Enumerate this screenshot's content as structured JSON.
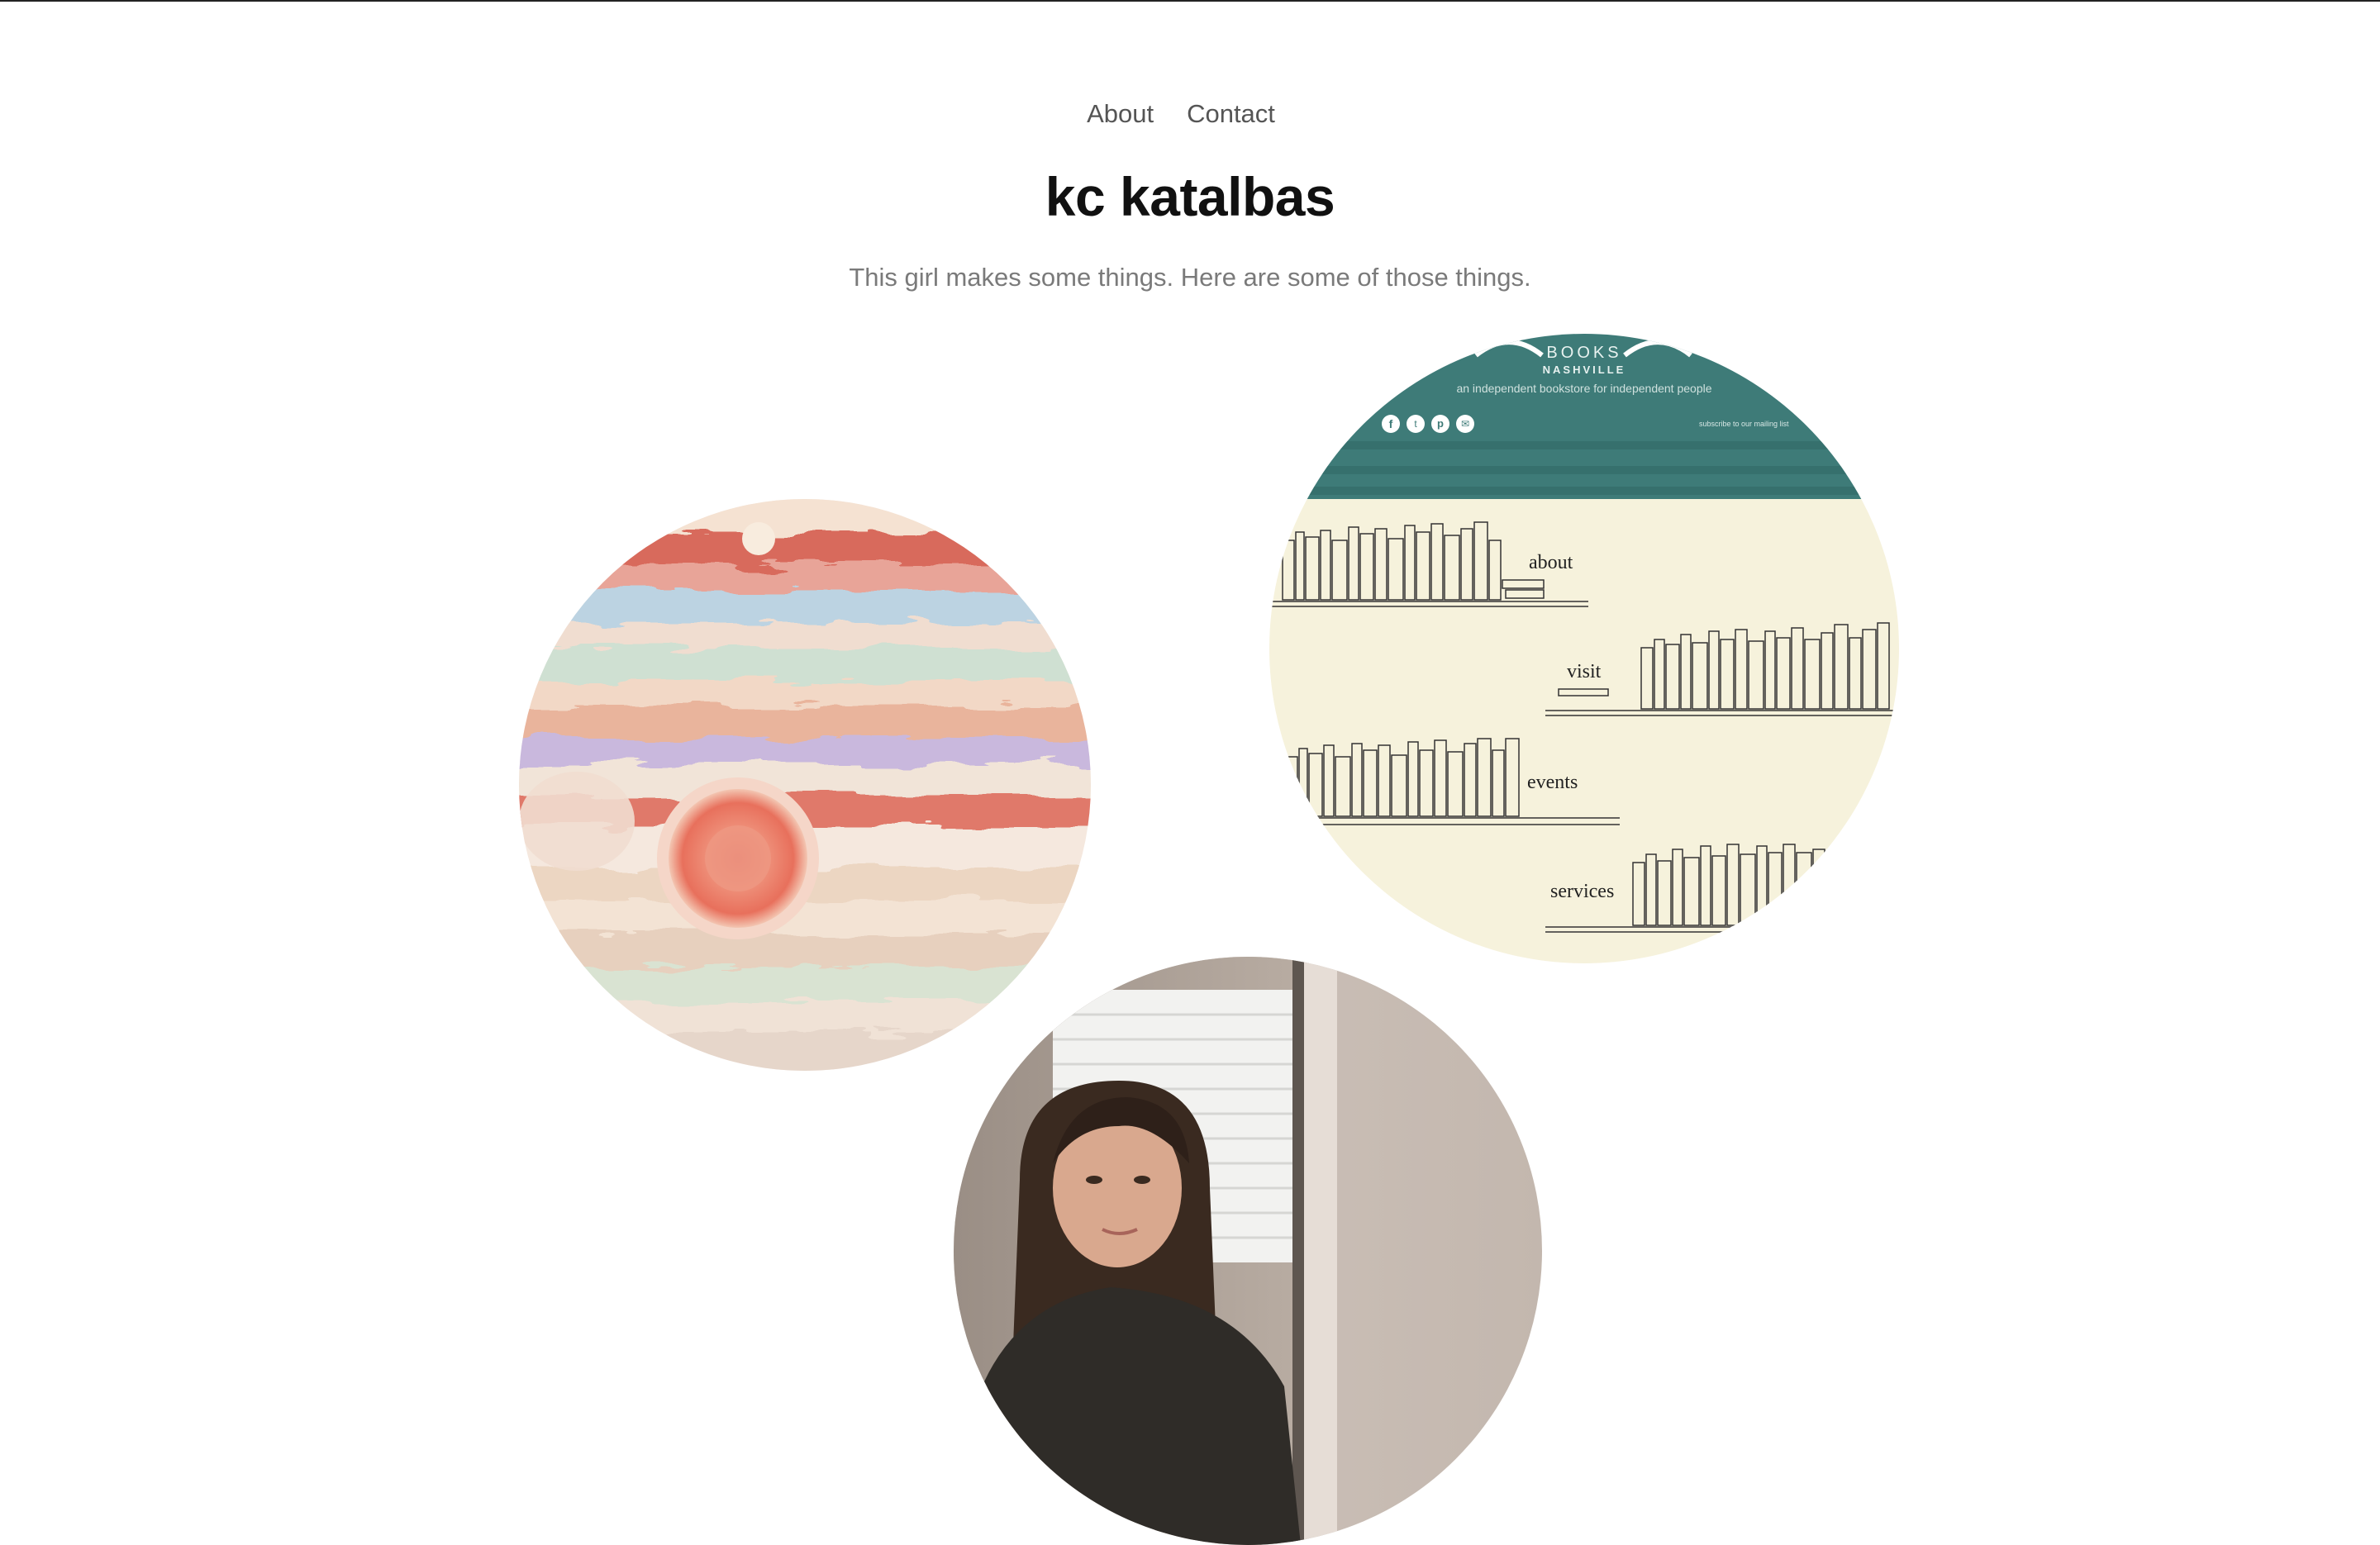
{
  "nav": {
    "about": "About",
    "contact": "Contact"
  },
  "site": {
    "title": "kc katalbas",
    "tagline": "This girl makes some things. Here are some of those things."
  },
  "projects": {
    "jupiter": {
      "kind": "painting"
    },
    "bookstore": {
      "header_name": "BOOKS",
      "header_city": "NASHVILLE",
      "header_tagline": "an independent bookstore for independent people",
      "newsletter": "subscribe to our mailing list",
      "social": [
        "facebook-icon",
        "twitter-icon",
        "pinterest-icon",
        "email-icon"
      ],
      "menu": [
        "about",
        "visit",
        "events",
        "services"
      ]
    },
    "person": {
      "kind": "photo"
    }
  },
  "colors": {
    "title": "#111111",
    "nav": "#555555",
    "tagline": "#7a7a7a",
    "bookstore_header": "#3e7b78",
    "bookstore_bg": "#f6f2dc"
  }
}
